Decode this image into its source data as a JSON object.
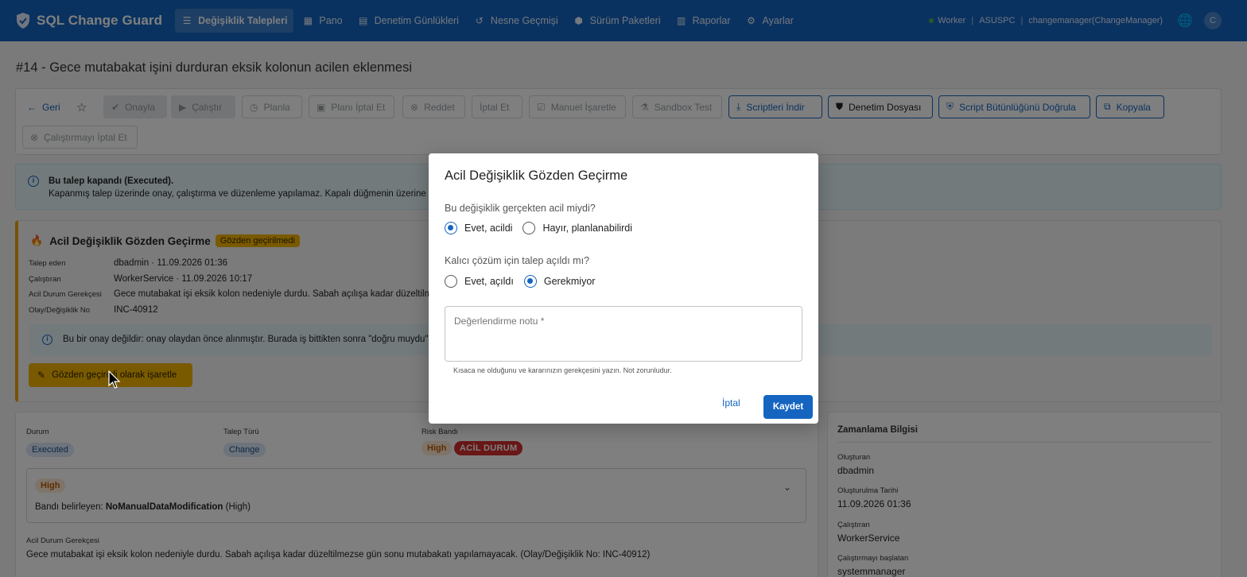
{
  "app": {
    "brand": "SQL Change Guard",
    "nav": [
      {
        "label": "Değişiklik Talepleri",
        "icon": "list-icon",
        "glyph": "☰",
        "active": true
      },
      {
        "label": "Pano",
        "icon": "dashboard-icon",
        "glyph": "▦",
        "active": false
      },
      {
        "label": "Denetim Günlükleri",
        "icon": "audit-log-icon",
        "glyph": "▤",
        "active": false
      },
      {
        "label": "Nesne Geçmişi",
        "icon": "history-icon",
        "glyph": "↺",
        "active": false
      },
      {
        "label": "Sürüm Paketleri",
        "icon": "package-icon",
        "glyph": "⬢",
        "active": false
      },
      {
        "label": "Raporlar",
        "icon": "report-icon",
        "glyph": "▥",
        "active": false
      },
      {
        "label": "Ayarlar",
        "icon": "gear-icon",
        "glyph": "⚙",
        "active": false
      }
    ],
    "status": {
      "worker": "Worker",
      "host": "ASUSPC",
      "user": "changemanager(ChangeManager)",
      "avatar": "C"
    }
  },
  "page": {
    "title": "#14 - Gece mutabakat işini durduran eksik kolonun acilen eklenmesi"
  },
  "toolbar": {
    "back": "Geri",
    "approve": "Onayla",
    "run": "Çalıştır",
    "plan": "Planla",
    "cancel_plan": "Planı İptal Et",
    "reject": "Reddet",
    "cancel": "İptal Et",
    "manual_mark": "Manuel İşaretle",
    "sandbox": "Sandbox Test",
    "download_scripts": "Scriptleri İndir",
    "audit_file": "Denetim Dosyası",
    "verify_integrity": "Script Bütünlüğünü Doğrula",
    "copy": "Kopyala",
    "cancel_run": "Çalıştırmayı İptal Et"
  },
  "closed_alert": {
    "title": "Bu talep kapandı (Executed).",
    "text": "Kapanmış talep üzerinde onay, çalıştırma ve düzenleme yapılamaz. Kapalı düğmenin üzerine ge"
  },
  "emergency_card": {
    "title": "Acil Değişiklik Gözden Geçirme",
    "badge": "Gözden geçirilmedi",
    "fields": [
      {
        "key": "Talep eden",
        "value": "dbadmin · 11.09.2026 01:36"
      },
      {
        "key": "Çalıştıran",
        "value": "WorkerService · 11.09.2026 10:17"
      },
      {
        "key": "Acil Durum Gerekçesi",
        "value": "Gece mutabakat işi eksik kolon nedeniyle durdu. Sabah açılışa kadar düzeltilme"
      },
      {
        "key": "Olay/Değişiklik No",
        "value": "INC-40912"
      }
    ],
    "note": "Bu bir onay değildir: onay olaydan önce alınmıştır. Burada iş bittikten sonra \"doğru muydu\" s",
    "review_button": "Gözden geçirildi olarak işaretle"
  },
  "details": {
    "status_label": "Durum",
    "status_value": "Executed",
    "type_label": "Talep Türü",
    "type_value": "Change",
    "risk_label": "Risk Bandı",
    "risk_value": "High",
    "emergency_chip": "ACİL DURUM",
    "risk_box_chip": "High",
    "risk_determined_prefix": "Bandı belirleyen:",
    "risk_rule": "NoManualDataModification",
    "risk_rule_suffix": "(High)",
    "reason_label": "Acil Durum Gerekçesi",
    "reason_value": "Gece mutabakat işi eksik kolon nedeniyle durdu. Sabah açılışa kadar düzeltilmezse gün sonu mutabakatı yapılamayacak. (Olay/Değişiklik No: INC-40912)"
  },
  "timing": {
    "title": "Zamanlama Bilgisi",
    "fields": [
      {
        "key": "Oluşturan",
        "value": "dbadmin"
      },
      {
        "key": "Oluşturulma Tarihi",
        "value": "11.09.2026 01:36"
      },
      {
        "key": "Çalıştıran",
        "value": "WorkerService"
      },
      {
        "key": "Çalıştırmayı başlatan",
        "value": "systemmanager"
      }
    ]
  },
  "modal": {
    "title": "Acil Değişiklik Gözden Geçirme",
    "q1": "Bu değişiklik gerçekten acil miydi?",
    "q1_yes": "Evet, acildi",
    "q1_no": "Hayır, planlanabilirdi",
    "q1_selected": "yes",
    "q2": "Kalıcı çözüm için talep açıldı mı?",
    "q2_yes": "Evet, açıldı",
    "q2_no": "Gerekmiyor",
    "q2_selected": "no",
    "note_placeholder": "Değerlendirme notu *",
    "note_value": "",
    "helper": "Kısaca ne olduğunu ve kararınızın gerekçesini yazın. Not zorunludur.",
    "cancel": "İptal",
    "save": "Kaydet"
  }
}
